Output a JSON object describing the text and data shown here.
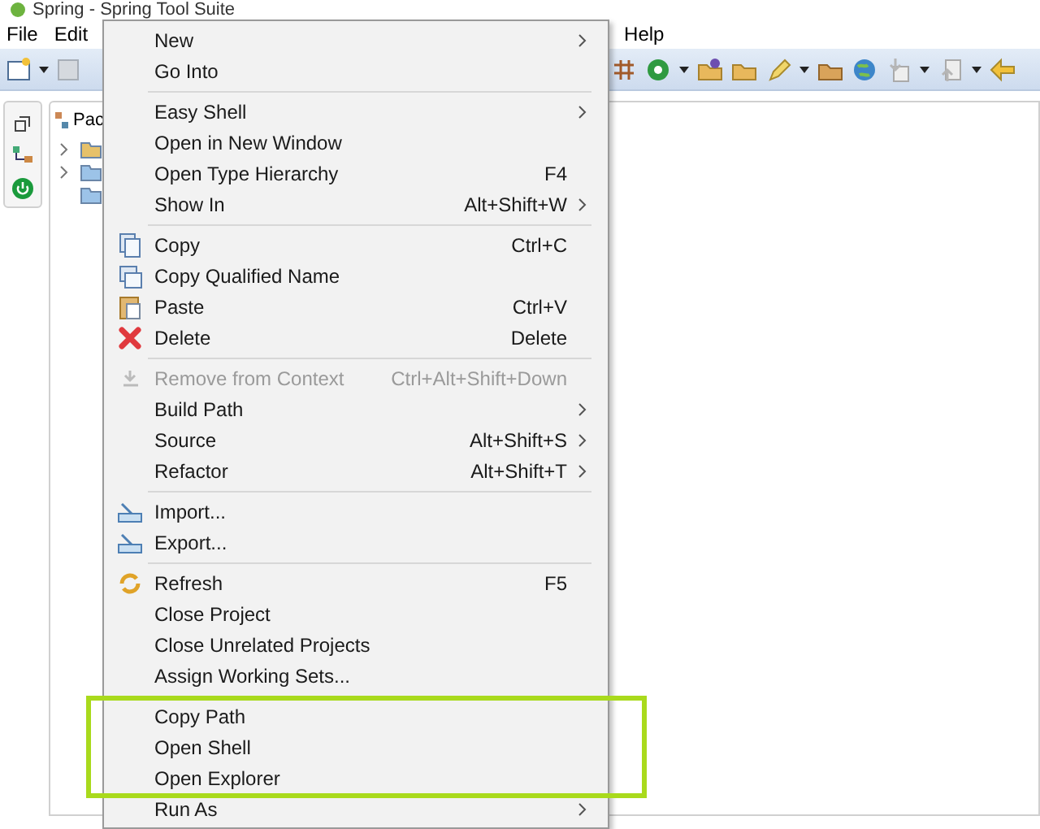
{
  "window": {
    "title": "Spring - Spring Tool Suite"
  },
  "menu_bar": [
    {
      "label": "File"
    },
    {
      "label": "Edit"
    },
    {
      "label": "Help"
    }
  ],
  "package_explorer": {
    "tab": "Pac",
    "tree": [
      {
        "expandable": true
      },
      {
        "expandable": true
      },
      {
        "expandable": false
      }
    ]
  },
  "context_menu": [
    {
      "kind": "item",
      "label": "New",
      "submenu": true
    },
    {
      "kind": "item",
      "label": "Go Into"
    },
    {
      "kind": "separator"
    },
    {
      "kind": "item",
      "label": "Easy Shell",
      "submenu": true
    },
    {
      "kind": "item",
      "label": "Open in New Window"
    },
    {
      "kind": "item",
      "label": "Open Type Hierarchy",
      "shortcut": "F4"
    },
    {
      "kind": "item",
      "label": "Show In",
      "shortcut": "Alt+Shift+W",
      "submenu": true
    },
    {
      "kind": "separator"
    },
    {
      "kind": "item",
      "label": "Copy",
      "shortcut": "Ctrl+C"
    },
    {
      "kind": "item",
      "label": "Copy Qualified Name"
    },
    {
      "kind": "item",
      "label": "Paste",
      "shortcut": "Ctrl+V"
    },
    {
      "kind": "item",
      "label": "Delete",
      "shortcut": "Delete"
    },
    {
      "kind": "separator"
    },
    {
      "kind": "item",
      "label": "Remove from Context",
      "shortcut": "Ctrl+Alt+Shift+Down",
      "disabled": true
    },
    {
      "kind": "item",
      "label": "Build Path",
      "submenu": true
    },
    {
      "kind": "item",
      "label": "Source",
      "shortcut": "Alt+Shift+S",
      "submenu": true
    },
    {
      "kind": "item",
      "label": "Refactor",
      "shortcut": "Alt+Shift+T",
      "submenu": true
    },
    {
      "kind": "separator"
    },
    {
      "kind": "item",
      "label": "Import..."
    },
    {
      "kind": "item",
      "label": "Export..."
    },
    {
      "kind": "separator"
    },
    {
      "kind": "item",
      "label": "Refresh",
      "shortcut": "F5"
    },
    {
      "kind": "item",
      "label": "Close Project"
    },
    {
      "kind": "item",
      "label": "Close Unrelated Projects"
    },
    {
      "kind": "item",
      "label": "Assign Working Sets..."
    },
    {
      "kind": "separator"
    },
    {
      "kind": "item",
      "label": "Copy Path",
      "highlighted": true
    },
    {
      "kind": "item",
      "label": "Open Shell",
      "highlighted": true
    },
    {
      "kind": "item",
      "label": "Open Explorer",
      "highlighted": true
    },
    {
      "kind": "item",
      "label": "Run As",
      "submenu": true
    }
  ]
}
